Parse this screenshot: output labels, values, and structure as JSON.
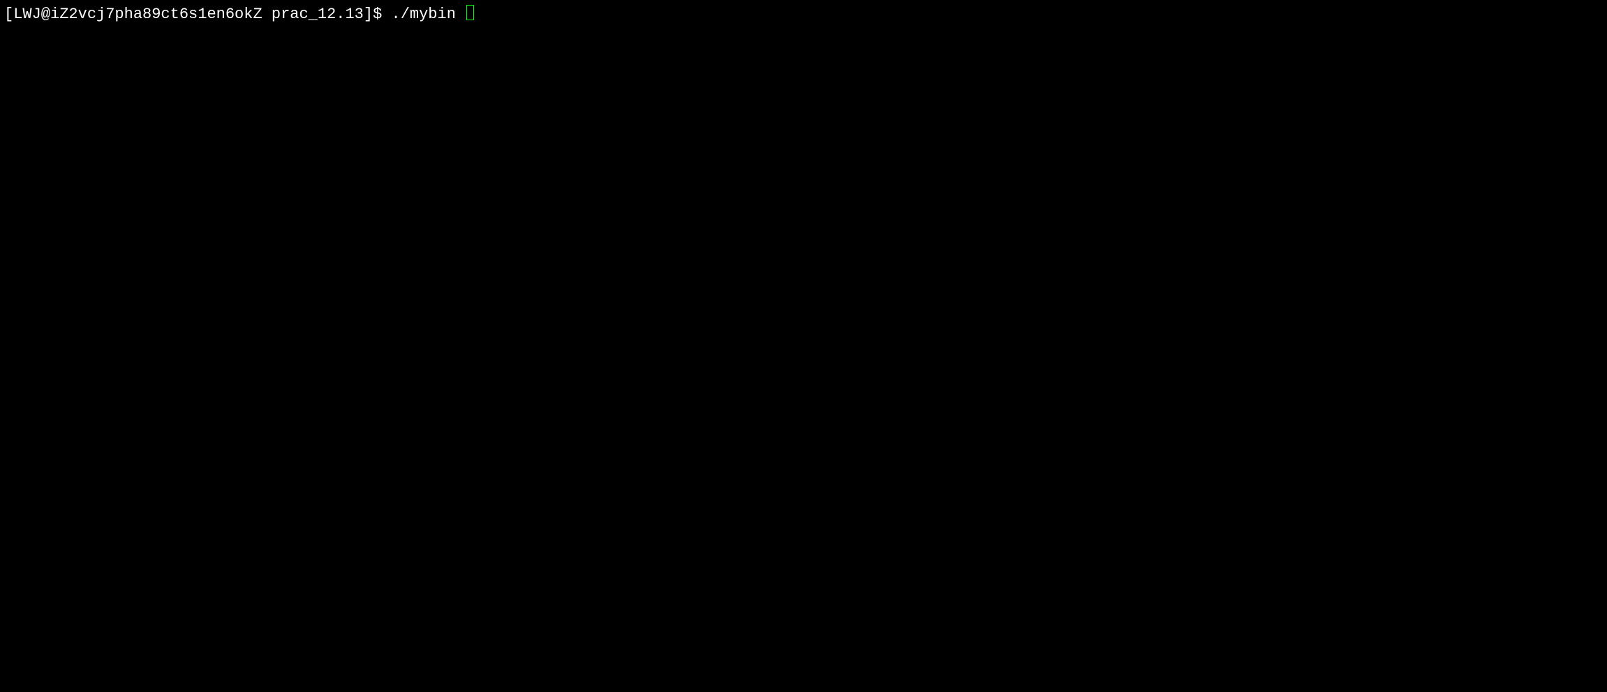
{
  "terminal": {
    "prompt": "[LWJ@iZ2vcj7pha89ct6s1en6okZ prac_12.13]$ ",
    "command": "./mybin "
  }
}
